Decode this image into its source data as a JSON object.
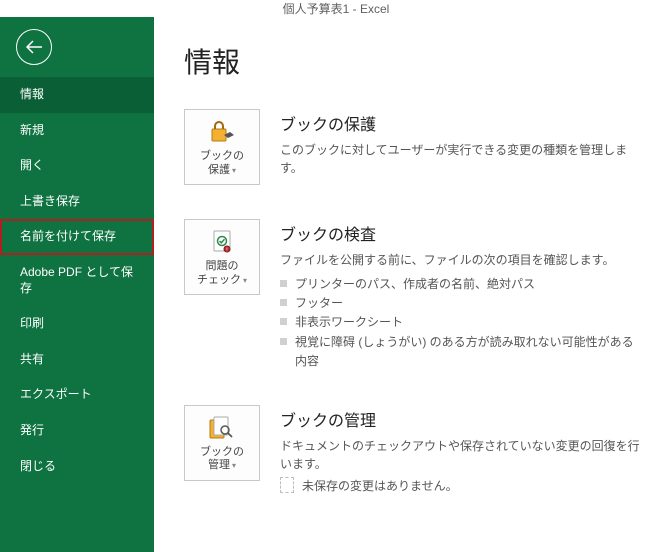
{
  "titlebar": "個人予算表1  -  Excel",
  "sidebar": {
    "items": [
      {
        "label": "情報",
        "active": true
      },
      {
        "label": "新規"
      },
      {
        "label": "開く"
      },
      {
        "label": "上書き保存"
      },
      {
        "label": "名前を付けて保存",
        "highlight": true
      },
      {
        "label": "Adobe PDF として保存"
      },
      {
        "label": "印刷"
      },
      {
        "label": "共有"
      },
      {
        "label": "エクスポート"
      },
      {
        "label": "発行"
      },
      {
        "label": "閉じる"
      }
    ]
  },
  "page": {
    "title": "情報"
  },
  "protect": {
    "btn_l1": "ブックの",
    "btn_l2": "保護",
    "heading": "ブックの保護",
    "desc": "このブックに対してユーザーが実行できる変更の種類を管理します。"
  },
  "inspect": {
    "btn_l1": "問題の",
    "btn_l2": "チェック",
    "heading": "ブックの検査",
    "desc": "ファイルを公開する前に、ファイルの次の項目を確認します。",
    "b1": "プリンターのパス、作成者の名前、絶対パス",
    "b2": "フッター",
    "b3": "非表示ワークシート",
    "b4": "視覚に障碍 (しょうがい) のある方が読み取れない可能性がある内容"
  },
  "manage": {
    "btn_l1": "ブックの",
    "btn_l2": "管理",
    "heading": "ブックの管理",
    "desc": "ドキュメントのチェックアウトや保存されていない変更の回復を行います。",
    "none": "未保存の変更はありません。"
  }
}
